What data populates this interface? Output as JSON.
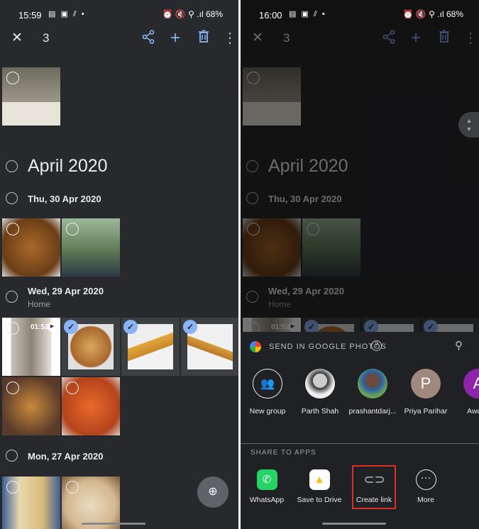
{
  "left": {
    "status_time": "15:59"
  },
  "right": {
    "status_time": "16:00"
  },
  "status": {
    "battery": "68%",
    "icons": "▤ ▣ ⫽ •",
    "right_icons": "⏰ 🔇 ⚲ .ıl"
  },
  "toolbar": {
    "selected_count": "3",
    "close": "✕",
    "share": "share-icon",
    "add": "+",
    "delete": "trash-icon",
    "more": "⋮"
  },
  "gallery": {
    "month": "April 2020",
    "days": [
      {
        "label": "Thu, 30 Apr 2020"
      },
      {
        "label": "Wed, 29 Apr 2020",
        "location": "Home"
      },
      {
        "label": "Mon, 27 Apr 2020"
      }
    ],
    "video_duration": "01:52",
    "selected_photos": 3
  },
  "share_sheet": {
    "title": "SEND IN GOOGLE PHOTOS",
    "contacts": [
      {
        "name": "New group",
        "initial": ""
      },
      {
        "name": "Parth Shah",
        "initial": ""
      },
      {
        "name": "prashantdarj...",
        "initial": ""
      },
      {
        "name": "Priya Parihar",
        "initial": "P",
        "color": "#a1887f"
      },
      {
        "name": "Awdhe",
        "initial": "A",
        "color": "#8e24aa"
      }
    ],
    "apps_title": "SHARE TO APPS",
    "apps": [
      {
        "name": "WhatsApp"
      },
      {
        "name": "Save to Drive"
      },
      {
        "name": "Create link",
        "highlighted": true
      },
      {
        "name": "More"
      }
    ],
    "highlight_color": "#d93025"
  }
}
